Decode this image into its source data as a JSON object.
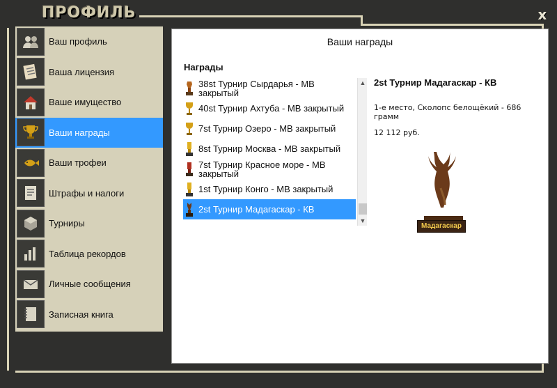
{
  "window": {
    "title": "ПРОФИЛЬ",
    "close_symbol": "x"
  },
  "sidebar": {
    "items": [
      {
        "label": "Ваш профиль",
        "icon": "users-icon",
        "active": false
      },
      {
        "label": "Ваша лицензия",
        "icon": "license-icon",
        "active": false
      },
      {
        "label": "Ваше имущество",
        "icon": "house-icon",
        "active": false
      },
      {
        "label": "Ваши награды",
        "icon": "trophy-icon",
        "active": true
      },
      {
        "label": "Ваши трофеи",
        "icon": "fish-icon",
        "active": false
      },
      {
        "label": "Штрафы и налоги",
        "icon": "fines-icon",
        "active": false
      },
      {
        "label": "Турниры",
        "icon": "tournament-icon",
        "active": false
      },
      {
        "label": "Таблица рекордов",
        "icon": "chart-icon",
        "active": false
      },
      {
        "label": "Личные сообщения",
        "icon": "envelope-icon",
        "active": false
      },
      {
        "label": "Записная книга",
        "icon": "notebook-icon",
        "active": false
      }
    ]
  },
  "panel": {
    "title": "Ваши награды",
    "list_heading": "Награды",
    "awards": [
      {
        "label": "38st Турнир Сырдарья - МВ закрытый",
        "trophy": "bronze"
      },
      {
        "label": "40st Турнир Ахтуба - МВ закрытый",
        "trophy": "gold-cup"
      },
      {
        "label": "7st Турнир Озеро - МВ закрытый",
        "trophy": "gold-cup"
      },
      {
        "label": "8st Турнир Москва - МВ закрытый",
        "trophy": "gold"
      },
      {
        "label": "7st Турнир Красное море - МВ закрытый",
        "trophy": "red"
      },
      {
        "label": "1st Турнир Конго - МВ закрытый",
        "trophy": "gold"
      },
      {
        "label": "2st Турнир Мадагаскар - КВ",
        "trophy": "wood",
        "selected": true
      }
    ],
    "detail": {
      "title": "2st Турнир Мадагаскар - КВ",
      "description": "1-е место, Сколопс белощёкий - 686 грамм",
      "prize": "12 112 руб.",
      "plaque": "Мадагаскар"
    }
  },
  "colors": {
    "accent": "#3399ff",
    "sidebar_bg": "#d6d1b9",
    "frame_bg": "#2f2f2d"
  }
}
